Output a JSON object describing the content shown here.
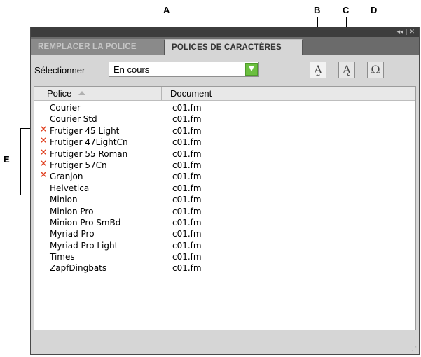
{
  "callouts": {
    "a": "A",
    "b": "B",
    "c": "C",
    "d": "D",
    "e": "E"
  },
  "titlebar": {
    "controls": "◂◂ | ✕"
  },
  "tabs": [
    {
      "label": "REMPLACER LA POLICE",
      "active": false
    },
    {
      "label": "POLICES DE CARACTÈRES",
      "active": true
    }
  ],
  "select": {
    "label": "Sélectionner",
    "value": "En cours"
  },
  "toolbar": {
    "replace_icon": "font-replace-icon",
    "find_icon": "font-find-icon",
    "refresh_icon": "refresh-icon"
  },
  "list": {
    "columns": [
      "Police",
      "Document"
    ],
    "rows": [
      {
        "font": "Courier",
        "doc": "c01.fm",
        "missing": false
      },
      {
        "font": "Courier Std",
        "doc": "c01.fm",
        "missing": false
      },
      {
        "font": "Frutiger 45 Light",
        "doc": "c01.fm",
        "missing": true
      },
      {
        "font": "Frutiger 47LightCn",
        "doc": "c01.fm",
        "missing": true
      },
      {
        "font": "Frutiger 55 Roman",
        "doc": "c01.fm",
        "missing": true
      },
      {
        "font": "Frutiger 57Cn",
        "doc": "c01.fm",
        "missing": true
      },
      {
        "font": "Granjon",
        "doc": "c01.fm",
        "missing": true
      },
      {
        "font": "Helvetica",
        "doc": "c01.fm",
        "missing": false
      },
      {
        "font": "Minion",
        "doc": "c01.fm",
        "missing": false
      },
      {
        "font": "Minion Pro",
        "doc": "c01.fm",
        "missing": false
      },
      {
        "font": "Minion Pro SmBd",
        "doc": "c01.fm",
        "missing": false
      },
      {
        "font": "Myriad Pro",
        "doc": "c01.fm",
        "missing": false
      },
      {
        "font": "Myriad Pro Light",
        "doc": "c01.fm",
        "missing": false
      },
      {
        "font": "Times",
        "doc": "c01.fm",
        "missing": false
      },
      {
        "font": "ZapfDingbats",
        "doc": "c01.fm",
        "missing": false
      }
    ]
  },
  "colors": {
    "missing_marker": "#e04020",
    "combo_button": "#6bbf3f"
  }
}
